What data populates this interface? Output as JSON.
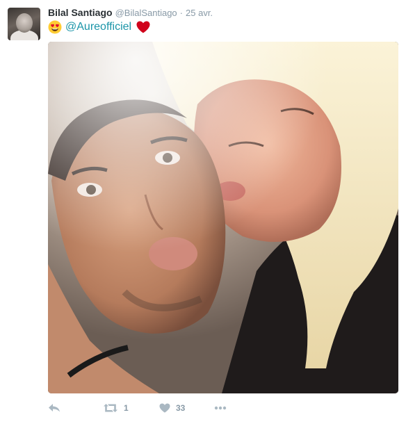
{
  "tweet": {
    "author_name": "Bilal Santiago",
    "author_handle": "@BilalSantiago",
    "separator": "·",
    "date": "25 avr.",
    "text_leading_emoji": "heart-eyes-emoji",
    "mention": "@Aureofficiel",
    "text_trailing_emoji": "red-heart-emoji"
  },
  "actions": {
    "reply_icon": "reply-icon",
    "retweet_icon": "retweet-icon",
    "retweet_count": "1",
    "like_icon": "heart-icon",
    "like_count": "33",
    "more_icon": "more-dots-icon"
  },
  "colors": {
    "name": "#292f33",
    "secondary": "#8899a6",
    "mention": "#1b95a8",
    "action_icon": "#aab8c2",
    "heart": "#e0112b"
  }
}
